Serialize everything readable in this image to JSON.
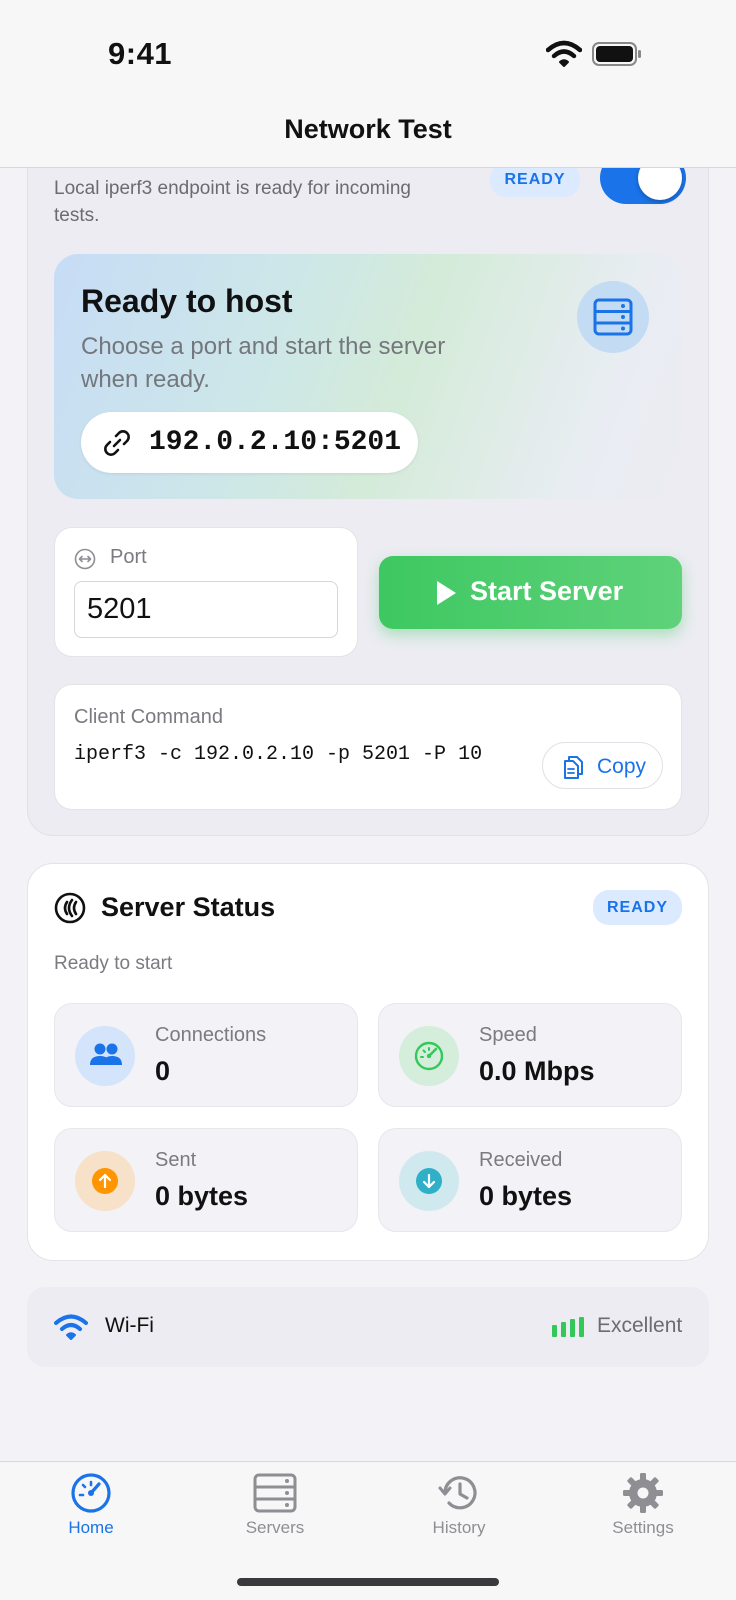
{
  "status_bar": {
    "time": "9:41"
  },
  "nav": {
    "title": "Network Test"
  },
  "server_panel": {
    "subtitle": "Local iperf3 endpoint is ready for incoming tests.",
    "badge": "READY",
    "toggle_on": true,
    "host": {
      "title": "Ready to host",
      "subtitle": "Choose a port and start the server when ready.",
      "address": "192.0.2.10:5201"
    },
    "port": {
      "label": "Port",
      "value": "5201"
    },
    "start_button": "Start Server",
    "client_command": {
      "label": "Client Command",
      "command": "iperf3 -c 192.0.2.10 -p 5201 -P 10",
      "copy_label": "Copy"
    }
  },
  "server_status": {
    "title": "Server Status",
    "badge": "READY",
    "subtitle": "Ready to start",
    "metrics": [
      {
        "label": "Connections",
        "value": "0",
        "icon": "users-icon",
        "color": "#1a73e8"
      },
      {
        "label": "Speed",
        "value": "0.0 Mbps",
        "icon": "speedometer-icon",
        "color": "#34c759"
      },
      {
        "label": "Sent",
        "value": "0 bytes",
        "icon": "arrow-up-icon",
        "color": "#ff9500"
      },
      {
        "label": "Received",
        "value": "0 bytes",
        "icon": "arrow-down-icon",
        "color": "#30b0c7"
      }
    ]
  },
  "network": {
    "type": "Wi-Fi",
    "quality": "Excellent",
    "accent": "#34c759"
  },
  "tabs": [
    {
      "label": "Home",
      "icon": "gauge-icon",
      "active": true
    },
    {
      "label": "Servers",
      "icon": "server-icon",
      "active": false
    },
    {
      "label": "History",
      "icon": "history-icon",
      "active": false
    },
    {
      "label": "Settings",
      "icon": "gear-icon",
      "active": false
    }
  ],
  "colors": {
    "accent": "#1a73e8",
    "success": "#34c759",
    "background": "#f2f2f7"
  }
}
